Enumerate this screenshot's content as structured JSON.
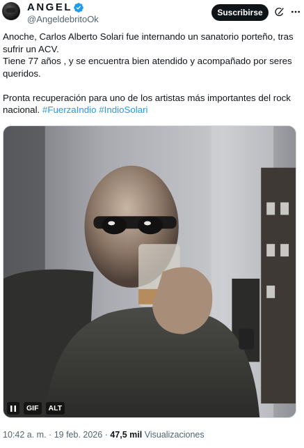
{
  "header": {
    "display_name": "ANGEL",
    "handle": "@AngeldebritoOk",
    "subscribe_label": "Suscribirse",
    "verified_color": "#1d9bf0"
  },
  "tweet": {
    "line1": "Anoche, Carlos Alberto Solari fue internando un sanatorio porteño, tras sufrir un ACV.",
    "line2": "Tiene 77 años , y se encuentra bien atendido y acompañado por seres queridos.",
    "line3_text": "Pronta recuperación para uno de los artistas más importantes del rock nacional. ",
    "hashtag1": "#FuerzaIndio",
    "hashtag2": "#IndioSolari"
  },
  "media": {
    "type": "gif",
    "gif_label": "GIF",
    "alt_label": "ALT",
    "pause_icon": "pause-icon"
  },
  "meta": {
    "time": "10:42 a. m.",
    "separator": "·",
    "date": "19 feb. 2026",
    "views_count": "47,5 mil",
    "views_label": "Visualizaciones"
  },
  "icons": [
    "verified-badge-icon",
    "grok-icon",
    "more-icon",
    "pause-icon"
  ],
  "colors": {
    "accent": "#1d9bf0",
    "text": "#0f1419",
    "muted": "#536471",
    "button_bg": "#0f1419"
  }
}
